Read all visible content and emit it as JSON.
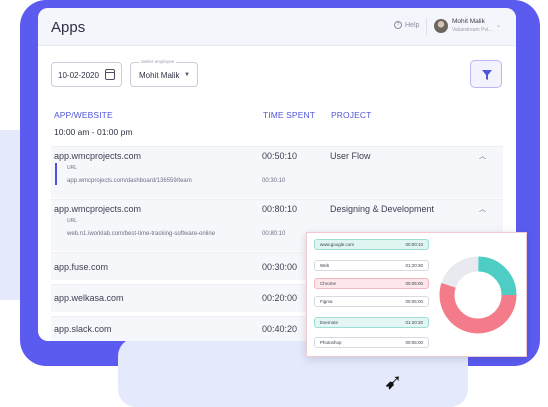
{
  "header": {
    "title": "Apps",
    "help_label": "Help",
    "user_name": "Mohit Malik",
    "user_org": "Valuestream Pvt..."
  },
  "filters": {
    "date_value": "10-02-2020",
    "employee_label": "Select employee",
    "employee_value": "Mohit Malik"
  },
  "table": {
    "columns": [
      "APP/WEBSITE",
      "TIME SPENT",
      "PROJECT"
    ],
    "time_range": "10:00 am - 01:00 pm",
    "url_label": "URL",
    "rows": [
      {
        "app": "app.wmcprojects.com",
        "time": "00:50:10",
        "project": "User Flow",
        "url": "app.wmcprojects.com/dashboard/136559/team",
        "url_time": "00:30:10"
      },
      {
        "app": "app.wmcprojects.com",
        "time": "00:80:10",
        "project": "Designing & Development",
        "url": "web.n1.iworklab.com/best-time-tracking-software-online",
        "url_time": "00:80:10"
      },
      {
        "app": "app.fuse.com",
        "time": "00:30:00",
        "project": ""
      },
      {
        "app": "app.welkasa.com",
        "time": "00:20:00",
        "project": ""
      },
      {
        "app": "app.slack.com",
        "time": "00:40:20",
        "project": ""
      }
    ]
  },
  "overlay": {
    "rows": [
      {
        "name": "www.google.com",
        "time": "00:00:10",
        "color": "#dff5f2",
        "border": "#9fded6"
      },
      {
        "name": "Web",
        "time": "01:20:30",
        "color": "#ffffff",
        "border": "#d7dae3"
      },
      {
        "name": "Chrome",
        "time": "00:05:00",
        "color": "#fde7ea",
        "border": "#f3b8c1"
      },
      {
        "name": "Figma",
        "time": "00:05:00",
        "color": "#ffffff",
        "border": "#d7dae3"
      },
      {
        "name": "Evernote",
        "time": "01:20:30",
        "color": "#e4f6f3",
        "border": "#9fded6"
      },
      {
        "name": "Photoshop",
        "time": "00:05:00",
        "color": "#ffffff",
        "border": "#d7dae3"
      }
    ],
    "chart_data": {
      "type": "pie",
      "donut": true,
      "slices": [
        {
          "value": 25,
          "color": "#4ecdc4"
        },
        {
          "value": 55,
          "color": "#f47c8a"
        },
        {
          "value": 20,
          "color": "#e8eaef"
        }
      ]
    }
  },
  "colors": {
    "accent": "#4f55d9",
    "backdrop": "#5b5bf0",
    "teal": "#4ecdc4",
    "pink": "#f47c8a"
  }
}
